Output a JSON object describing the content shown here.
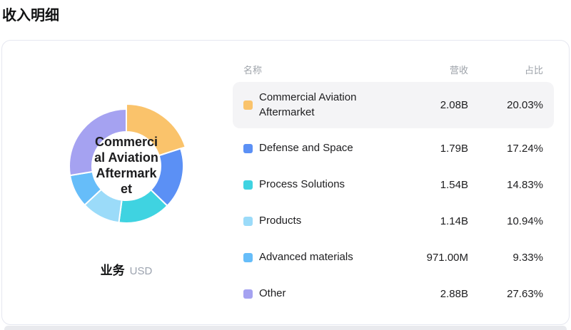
{
  "page_title": "收入明细",
  "chart_footer": {
    "dimension_label": "业务",
    "unit": "USD"
  },
  "table": {
    "headers": {
      "name": "名称",
      "revenue": "营收",
      "share": "占比"
    },
    "rows": [
      {
        "name": "Commercial Aviation Aftermarket",
        "revenue": "2.08B",
        "share": "20.03%",
        "color": "#fac36b",
        "highlighted": true
      },
      {
        "name": "Defense and Space",
        "revenue": "1.79B",
        "share": "17.24%",
        "color": "#5b90f5",
        "highlighted": false
      },
      {
        "name": "Process Solutions",
        "revenue": "1.54B",
        "share": "14.83%",
        "color": "#3fd3e1",
        "highlighted": false
      },
      {
        "name": "Products",
        "revenue": "1.14B",
        "share": "10.94%",
        "color": "#9bdbf9",
        "highlighted": false
      },
      {
        "name": "Advanced materials",
        "revenue": "971.00M",
        "share": "9.33%",
        "color": "#66bdf9",
        "highlighted": false
      },
      {
        "name": "Other",
        "revenue": "2.88B",
        "share": "27.63%",
        "color": "#a5a2f1",
        "highlighted": false
      }
    ]
  },
  "chart_data": {
    "type": "pie",
    "subtype": "donut",
    "title": "收入明细",
    "unit": "USD",
    "dimension_label": "业务",
    "legend_position": "right-table",
    "selected_slice": "Commercial Aviation Aftermarket",
    "center_label": "Commercial Aviation Aftermarket",
    "center_label_lines": [
      "Commerci",
      "al Aviation",
      "Aftermark",
      "et"
    ],
    "start_angle_deg": 0,
    "clockwise": true,
    "inner_radius_px": 48,
    "outer_radius_px": 80,
    "selected_outer_radius_px": 87,
    "categories": [
      "Commercial Aviation Aftermarket",
      "Defense and Space",
      "Process Solutions",
      "Products",
      "Advanced materials",
      "Other"
    ],
    "series": [
      {
        "name": "Commercial Aviation Aftermarket",
        "percent": 20.03,
        "revenue": "2.08B",
        "color": "#fac36b",
        "selected": true
      },
      {
        "name": "Defense and Space",
        "percent": 17.24,
        "revenue": "1.79B",
        "color": "#5b90f5",
        "selected": false
      },
      {
        "name": "Process Solutions",
        "percent": 14.83,
        "revenue": "1.54B",
        "color": "#3fd3e1",
        "selected": false
      },
      {
        "name": "Products",
        "percent": 10.94,
        "revenue": "1.14B",
        "color": "#9bdbf9",
        "selected": false
      },
      {
        "name": "Advanced materials",
        "percent": 9.33,
        "revenue": "971.00M",
        "color": "#66bdf9",
        "selected": false
      },
      {
        "name": "Other",
        "percent": 27.63,
        "revenue": "2.88B",
        "color": "#a5a2f1",
        "selected": false
      }
    ]
  }
}
